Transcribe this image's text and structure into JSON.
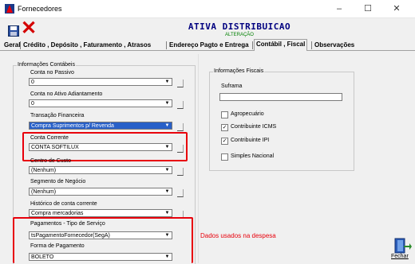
{
  "window": {
    "title": "Fornecedores",
    "min": "–",
    "max": "☐",
    "close": "✕"
  },
  "toolbar": {
    "company_name": "ATIVA DISTRIBUICAO",
    "mode": "ALTERAÇÃO",
    "close_glyph": "✕"
  },
  "tabs": [
    "Geral",
    "Crédito , Depósito , Faturamento , Atrasos",
    "Endereço Pagto e Entrega",
    "Contábil , Fiscal",
    "Observações"
  ],
  "active_tab_index": 3,
  "contabeis": {
    "title": "Informações Contábeis",
    "conta_passivo": {
      "label": "Conta no Passivo",
      "value": "0"
    },
    "conta_adiantamento": {
      "label": "Conta no Ativo Adiantamento",
      "value": "0"
    },
    "transacao": {
      "label": "Transação Financeira",
      "value": "Compra Suprimentos p/ Revenda"
    },
    "conta_corrente": {
      "label": "Conta Corrente",
      "value": "CONTA SOFTILUX"
    },
    "centro_custo": {
      "label": "Centro de Custo",
      "value": "(Nenhum)"
    },
    "segmento": {
      "label": "Segmento de Negócio",
      "value": "(Nenhum)"
    },
    "historico": {
      "label": "Histórico de conta corrente",
      "value": "Compra mercadorias"
    },
    "pagamentos_tipo": {
      "label": "Pagamentos - Tipo de Serviço",
      "value": "tsPagamentoFornecedor(SegA)"
    },
    "forma_pagamento": {
      "label": "Forma de Pagamento",
      "value": "BOLETO"
    }
  },
  "fiscais": {
    "title": "Informações Fiscais",
    "suframa_label": "Suframa",
    "suframa_value": "",
    "checkboxes": [
      {
        "label": "Agropecuário",
        "checked": false
      },
      {
        "label": "Contribuinte ICMS",
        "checked": true
      },
      {
        "label": "Contribuinte IPI",
        "checked": true
      },
      {
        "label": "Simples Nacional",
        "checked": false
      }
    ]
  },
  "note": "Dados usados na despesa",
  "exit_label": "Fechar",
  "glyphs": {
    "dropdown": "▼",
    "check": "✓"
  },
  "colors": {
    "highlight": "#e8000b",
    "selection": "#2860c8",
    "title_text": "#000080"
  }
}
